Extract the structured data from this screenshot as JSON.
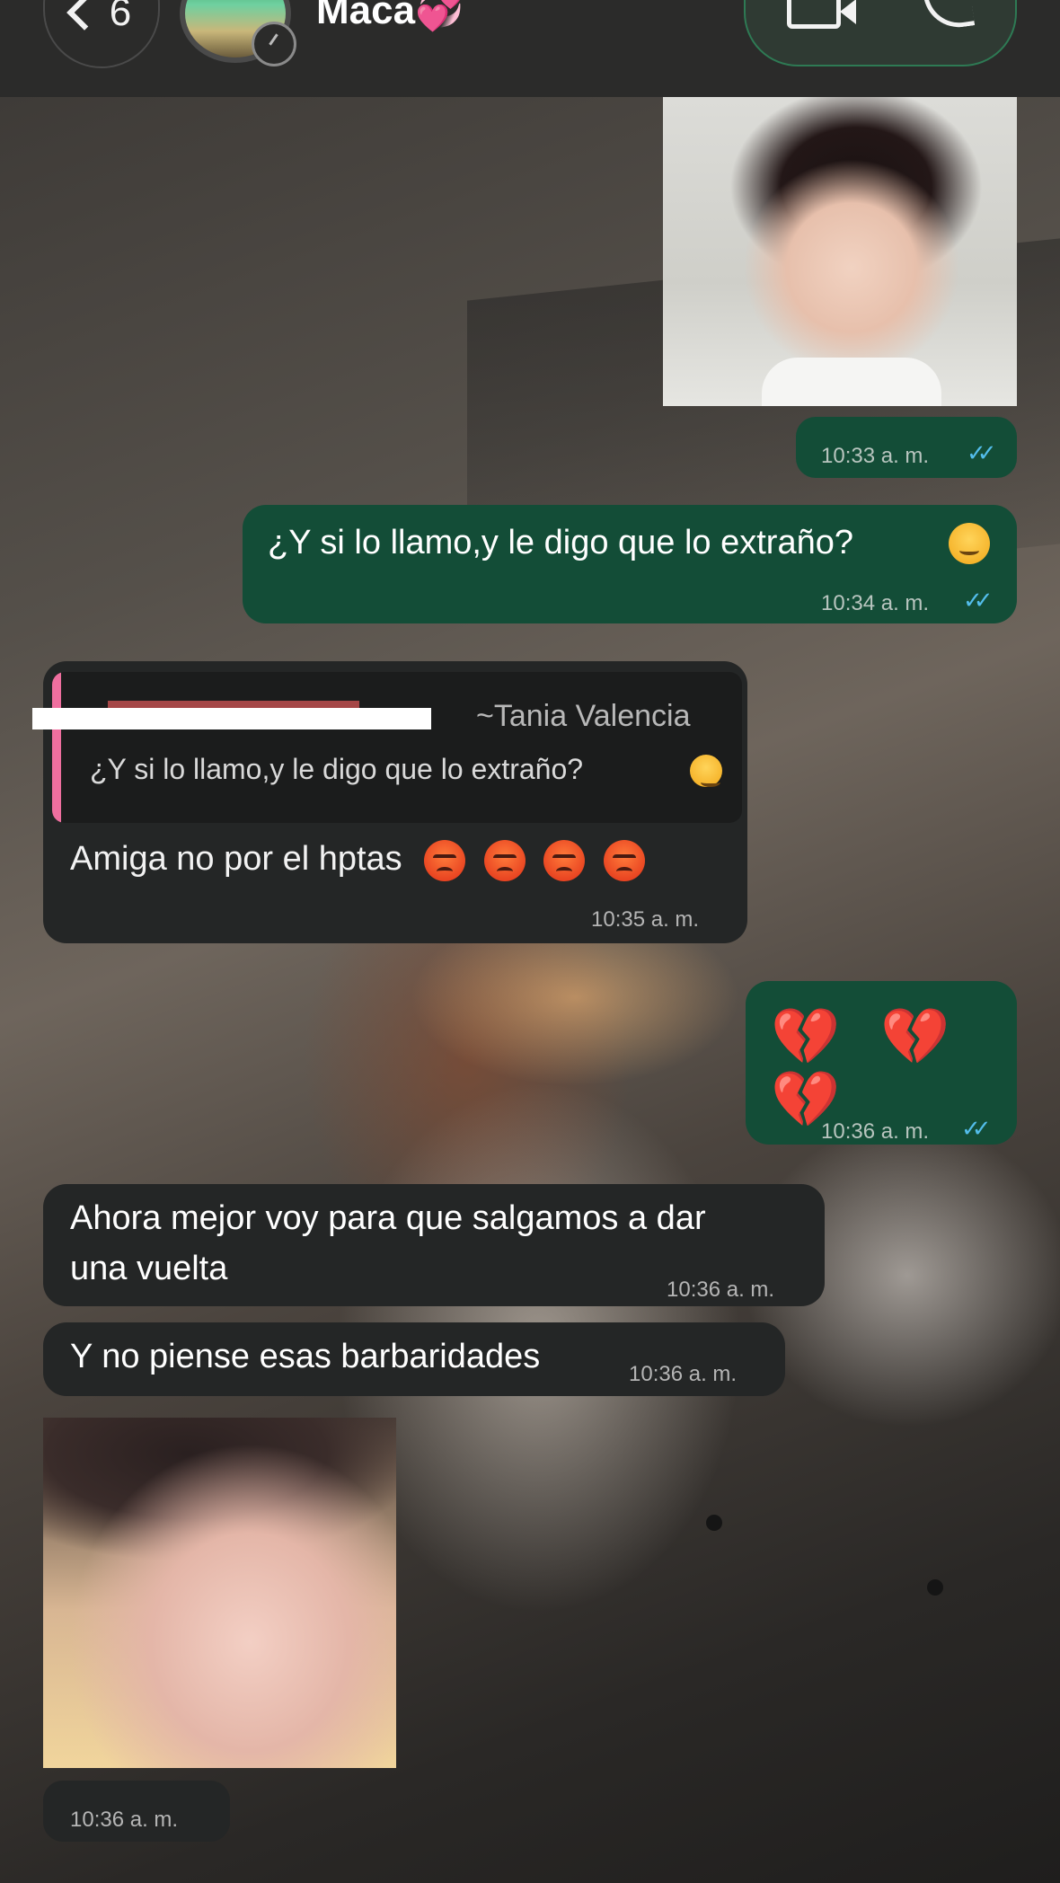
{
  "header": {
    "back_count": "6",
    "contact_name": "Maca💞"
  },
  "messages": {
    "m1_time": "10:33 a. m.",
    "m2_text": "¿Y si lo llamo,y le digo que lo extraño?",
    "m2_time": "10:34 a. m.",
    "m3_reply_author": "~Tania Valencia",
    "m3_reply_text": "¿Y si lo llamo,y le digo que lo extraño?",
    "m3_text": "Amiga no por el hptas",
    "m3_time": "10:35 a. m.",
    "m4_text": "💔 💔 💔",
    "m4_time": "10:36 a. m.",
    "m5_text_line1": "Ahora mejor voy para que salgamos a dar",
    "m5_text_line2": "una vuelta",
    "m5_time": "10:36 a. m.",
    "m6_text": "Y no piense esas barbaridades",
    "m6_time": "10:36 a. m.",
    "m7_time": "10:36 a. m.",
    "read_ticks": "✓✓"
  },
  "colors": {
    "outgoing_bubble": "#134d37",
    "incoming_bubble": "#242626",
    "read_tick": "#53bdeb",
    "reply_bar": "#ef6f9f"
  },
  "icons": [
    "chevron-left-icon",
    "video-call-icon",
    "phone-icon",
    "status-icon",
    "read-ticks-icon"
  ]
}
